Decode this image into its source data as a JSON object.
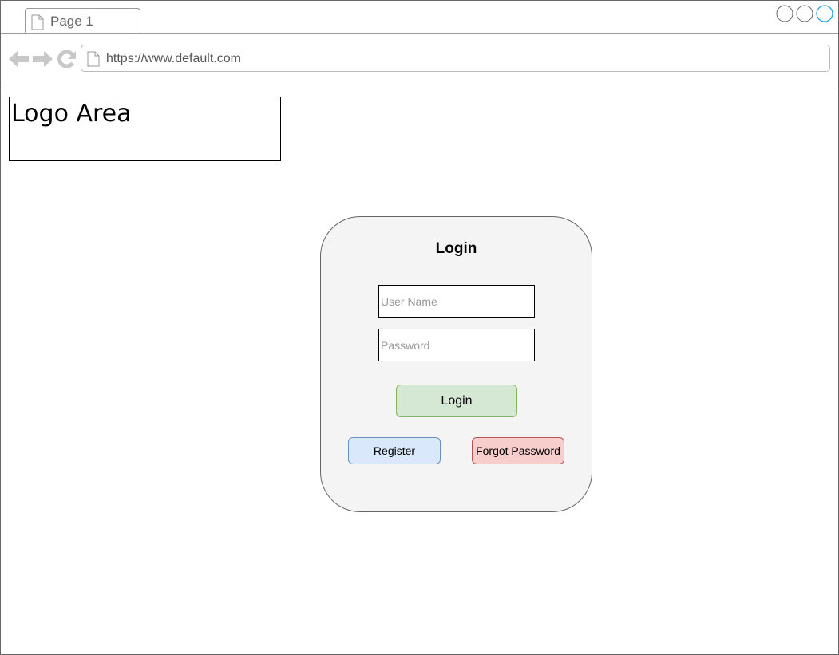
{
  "browser": {
    "tab_label": "Page 1",
    "url": "https://www.default.com",
    "controls_accent": "#1ba1e2"
  },
  "logo": {
    "text": "Logo Area"
  },
  "login": {
    "title": "Login",
    "username_placeholder": "User Name",
    "password_placeholder": "Password",
    "login_label": "Login",
    "register_label": "Register",
    "forgot_label": "Forgot Password",
    "colors": {
      "login_fill": "#d5e8d4",
      "register_fill": "#dae8fc",
      "forgot_fill": "#f8cecc"
    }
  }
}
